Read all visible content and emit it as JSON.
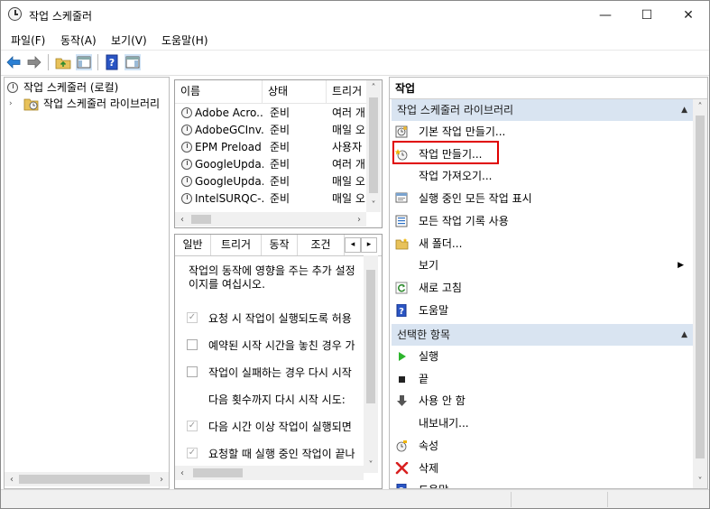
{
  "window": {
    "title": "작업 스케줄러",
    "minimize_glyph": "—",
    "maximize_glyph": "☐",
    "close_glyph": "✕"
  },
  "menu": [
    "파일(F)",
    "동작(A)",
    "보기(V)",
    "도움말(H)"
  ],
  "toolbar": {
    "icons": [
      "back-arrow-icon",
      "forward-arrow-icon",
      "folder-up-icon",
      "show-hide-console-tree-icon",
      "help-icon",
      "action-pane-icon"
    ]
  },
  "tree": {
    "root": "작업 스케줄러 (로컬)",
    "child": "작업 스케줄러 라이브러리"
  },
  "task_list": {
    "columns": [
      "이름",
      "상태",
      "트리거"
    ],
    "rows": [
      {
        "name": "Adobe Acro...",
        "status": "준비",
        "trigger": "여러 개"
      },
      {
        "name": "AdobeGCInv...",
        "status": "준비",
        "trigger": "매일 오"
      },
      {
        "name": "EPM Preload",
        "status": "준비",
        "trigger": "사용자"
      },
      {
        "name": "GoogleUpda...",
        "status": "준비",
        "trigger": "여러 개"
      },
      {
        "name": "GoogleUpda...",
        "status": "준비",
        "trigger": "매일 오"
      },
      {
        "name": "IntelSURQC-...",
        "status": "준비",
        "trigger": "매일 오"
      }
    ]
  },
  "detail": {
    "tabs": [
      "일반",
      "트리거",
      "동작",
      "조건"
    ],
    "description_line1": "작업의 동작에 영향을 주는 추가 설정",
    "description_line2": "이지를 여십시오.",
    "options": [
      {
        "label": "요청 시 작업이 실행되도록 허용",
        "checked": true,
        "disabled": true
      },
      {
        "label": "예약된 시작 시간을 놓친 경우 가",
        "checked": false,
        "disabled": false
      },
      {
        "label": "작업이 실패하는 경우 다시 시작",
        "checked": false,
        "disabled": false
      },
      {
        "label": "다음 횟수까지 다시 시작 시도:",
        "checked": null,
        "disabled": false
      },
      {
        "label": "다음 시간 이상 작업이 실행되면",
        "checked": true,
        "disabled": true
      },
      {
        "label": "요청할 때 실행 중인 작업이 끝나",
        "checked": true,
        "disabled": true
      }
    ]
  },
  "actions": {
    "header": "작업",
    "section1": {
      "title": "작업 스케줄러 라이브러리",
      "items": [
        {
          "label": "기본 작업 만들기...",
          "icon": "basic-task-icon"
        },
        {
          "label": "작업 만들기...",
          "icon": "create-task-icon"
        },
        {
          "label": "작업 가져오기...",
          "icon": ""
        },
        {
          "label": "실행 중인 모든 작업 표시",
          "icon": "running-tasks-icon"
        },
        {
          "label": "모든 작업 기록 사용",
          "icon": "history-icon"
        },
        {
          "label": "새 폴더...",
          "icon": "new-folder-icon"
        },
        {
          "label": "보기",
          "icon": "",
          "submenu_glyph": "▶"
        },
        {
          "label": "새로 고침",
          "icon": "refresh-icon"
        },
        {
          "label": "도움말",
          "icon": "help-icon"
        }
      ]
    },
    "section2": {
      "title": "선택한 항목",
      "items": [
        {
          "label": "실행",
          "icon": "run-icon"
        },
        {
          "label": "끝",
          "icon": "end-icon"
        },
        {
          "label": "사용 안 함",
          "icon": "disable-icon"
        },
        {
          "label": "내보내기...",
          "icon": ""
        },
        {
          "label": "속성",
          "icon": "properties-icon"
        },
        {
          "label": "삭제",
          "icon": "delete-icon"
        },
        {
          "label": "도움말",
          "icon": "help-icon"
        }
      ]
    },
    "collapse_glyph": "▲",
    "accent_color": "#d9e4f1",
    "highlight_color": "#e00000"
  }
}
